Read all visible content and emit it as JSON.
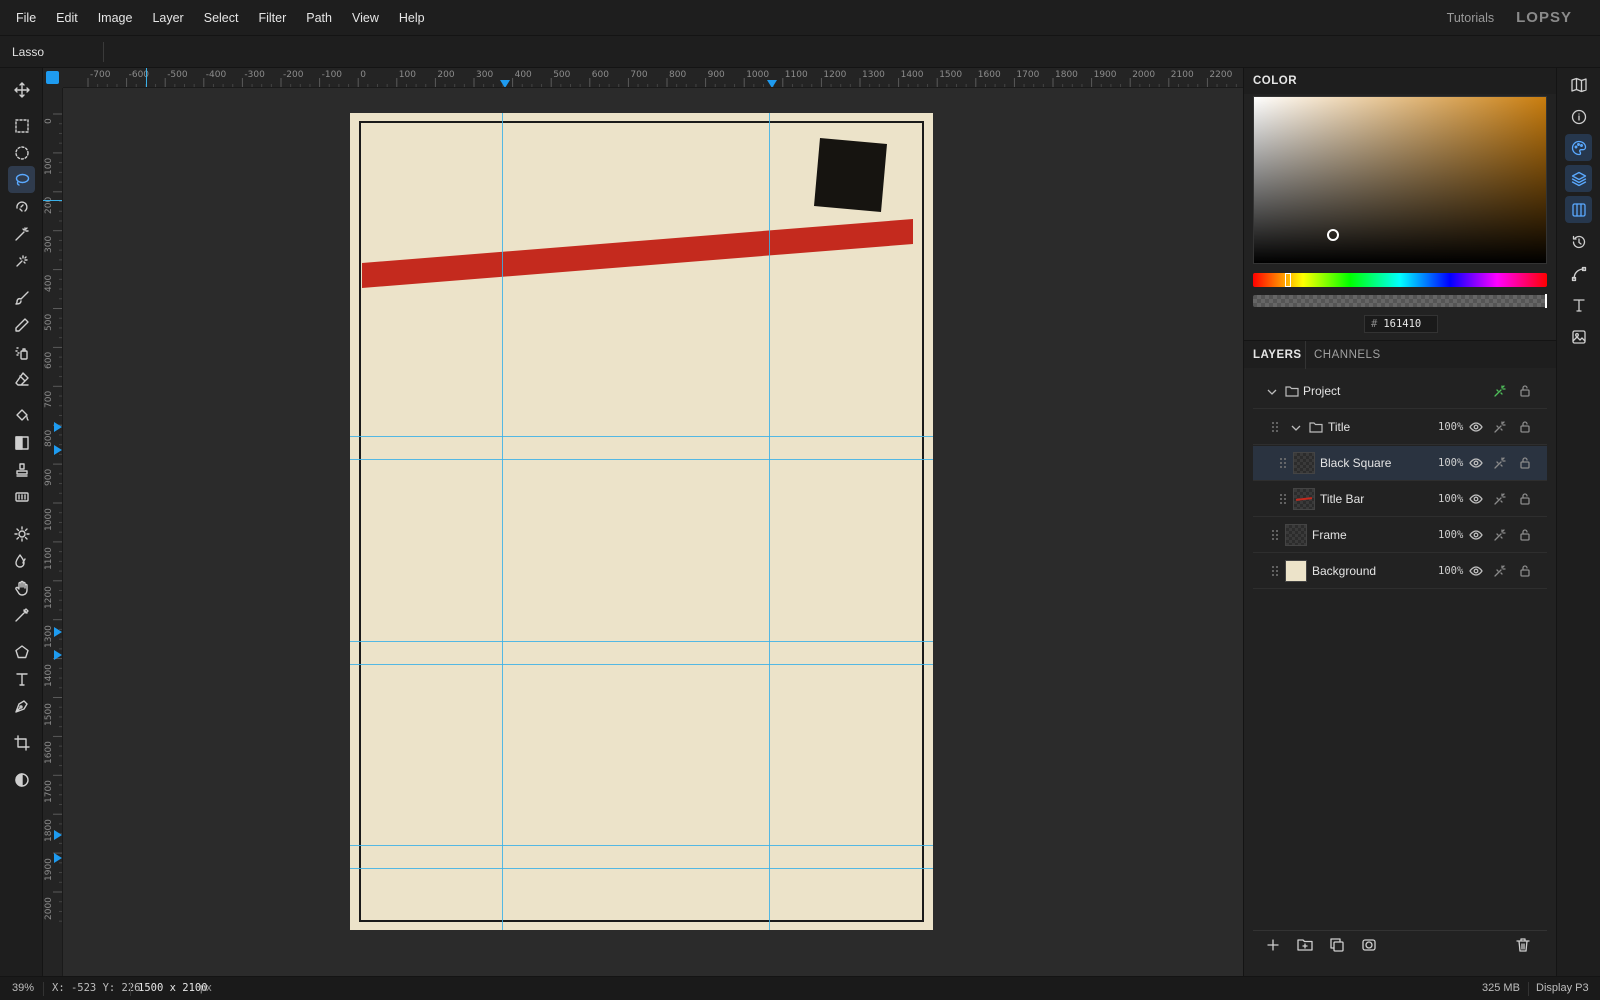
{
  "menu": [
    "File",
    "Edit",
    "Image",
    "Layer",
    "Select",
    "Filter",
    "Path",
    "View",
    "Help"
  ],
  "header": {
    "tutorials": "Tutorials",
    "logo": "LOPSY"
  },
  "options": {
    "tool_name": "Lasso"
  },
  "tools": [
    {
      "name": "move-icon",
      "active": false
    },
    {
      "name": "rect-select-icon",
      "active": false
    },
    {
      "name": "ellipse-select-icon",
      "active": false
    },
    {
      "name": "lasso-icon",
      "active": true
    },
    {
      "name": "magnetic-lasso-icon",
      "active": false
    },
    {
      "name": "magic-wand-icon",
      "active": false
    },
    {
      "name": "quick-select-icon",
      "active": false
    },
    {
      "name": "brush-icon",
      "active": false
    },
    {
      "name": "pencil-icon",
      "active": false
    },
    {
      "name": "spray-icon",
      "active": false
    },
    {
      "name": "eraser-icon",
      "active": false
    },
    {
      "name": "bucket-icon",
      "active": false
    },
    {
      "name": "gradient-icon",
      "active": false
    },
    {
      "name": "stamp-icon",
      "active": false
    },
    {
      "name": "pattern-icon",
      "active": false
    },
    {
      "name": "dodge-icon",
      "active": false
    },
    {
      "name": "blur-icon",
      "active": false
    },
    {
      "name": "hand-icon",
      "active": false
    },
    {
      "name": "eyedropper-icon",
      "active": false
    },
    {
      "name": "shape-icon",
      "active": false
    },
    {
      "name": "text-icon",
      "active": false
    },
    {
      "name": "pen-icon",
      "active": false
    },
    {
      "name": "crop-icon",
      "active": false
    },
    {
      "name": "contrast-icon",
      "active": false
    }
  ],
  "ruler": {
    "h_labels": [
      "-700",
      "-600",
      "-500",
      "-400",
      "-300",
      "-200",
      "-100",
      "0",
      "100",
      "200",
      "300",
      "400",
      "500",
      "600",
      "700",
      "800",
      "900",
      "1000",
      "1100",
      "1200",
      "1300",
      "1400",
      "1500",
      "1600",
      "1700",
      "1800",
      "1900",
      "2000",
      "2100",
      "2200"
    ],
    "v_labels": [
      "0",
      "100",
      "200",
      "300",
      "400",
      "500",
      "600",
      "700",
      "800",
      "900",
      "1000",
      "1100",
      "1200",
      "1300",
      "1400",
      "1500",
      "1600",
      "1700",
      "1800",
      "1900",
      "2000"
    ]
  },
  "canvas": {
    "background": "#ece3c9",
    "frame_color": "#1a1a1a",
    "bar_color": "#c42a1e",
    "square_color": "#161410"
  },
  "color_panel": {
    "title": "COLOR",
    "hash": "#",
    "hex": "161410"
  },
  "layers_panel": {
    "tabs": [
      "LAYERS",
      "CHANNELS"
    ],
    "layers": [
      {
        "name": "Project",
        "opacity": "",
        "selected": false
      },
      {
        "name": "Title",
        "opacity": "100%",
        "selected": false
      },
      {
        "name": "Black Square",
        "opacity": "100%",
        "selected": true
      },
      {
        "name": "Title Bar",
        "opacity": "100%",
        "selected": false
      },
      {
        "name": "Frame",
        "opacity": "100%",
        "selected": false
      },
      {
        "name": "Background",
        "opacity": "100%",
        "selected": false
      }
    ]
  },
  "status": {
    "zoom": "39%",
    "coords": "X: -523 Y: 226",
    "doc_size": "1500 x 2100",
    "unit": "px",
    "memory": "325 MB",
    "profile": "Display P3"
  }
}
